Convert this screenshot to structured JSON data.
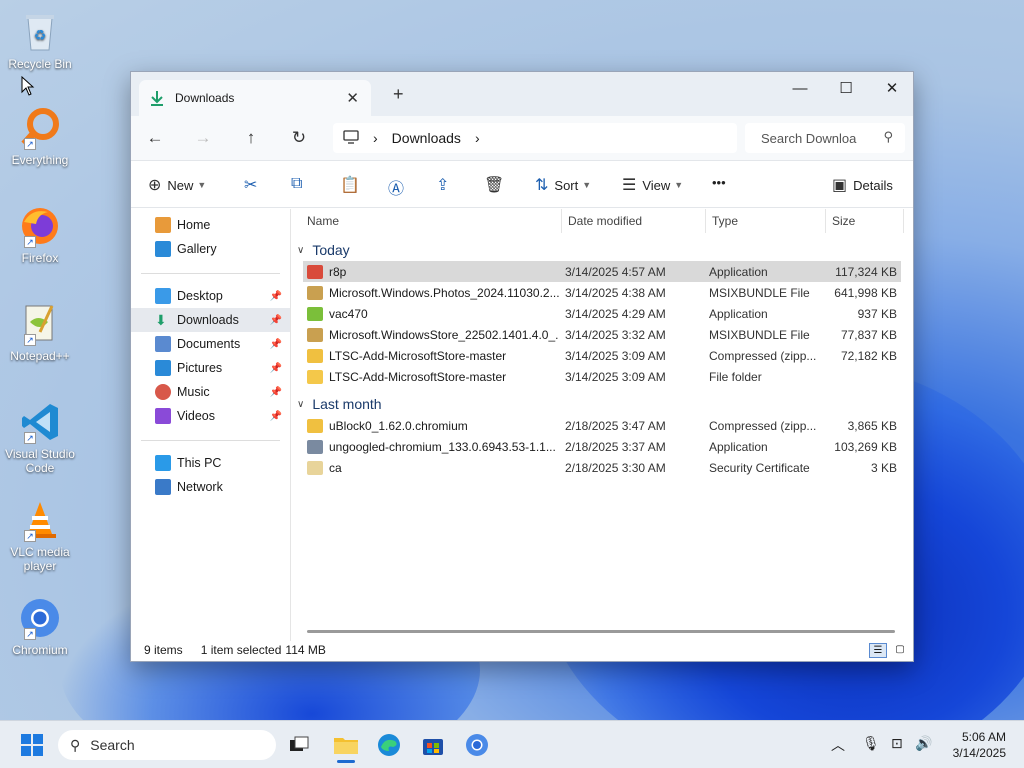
{
  "desktop": {
    "icons": [
      {
        "label": "Recycle Bin",
        "icon": "recycle-bin-icon"
      },
      {
        "label": "Everything",
        "icon": "everything-search-icon"
      },
      {
        "label": "Firefox",
        "icon": "firefox-icon"
      },
      {
        "label": "Notepad++",
        "icon": "notepadpp-icon"
      },
      {
        "label": "Visual Studio Code",
        "icon": "vscode-icon"
      },
      {
        "label": "VLC media player",
        "icon": "vlc-icon"
      },
      {
        "label": "Chromium",
        "icon": "chromium-icon"
      }
    ]
  },
  "window": {
    "tab_title": "Downloads",
    "new_tab": "+",
    "close_tab": "✕",
    "controls": {
      "minimize": "—",
      "maximize": "☐",
      "close": "✕"
    },
    "breadcrumb": {
      "location": "Downloads"
    },
    "search_placeholder": "Search Downloa",
    "toolbar": {
      "new": "New",
      "sort": "Sort",
      "view": "View",
      "more": "•••",
      "details": "Details"
    },
    "nav": {
      "home": "Home",
      "gallery": "Gallery",
      "desktop": "Desktop",
      "downloads": "Downloads",
      "documents": "Documents",
      "pictures": "Pictures",
      "music": "Music",
      "videos": "Videos",
      "this_pc": "This PC",
      "network": "Network"
    },
    "columns": {
      "name": "Name",
      "date": "Date modified",
      "type": "Type",
      "size": "Size"
    },
    "groups": {
      "today": "Today",
      "last_month": "Last month"
    },
    "files_today": [
      {
        "name": "r8p",
        "date": "3/14/2025 4:57 AM",
        "type": "Application",
        "size": "117,324 KB",
        "icon": "app-icon",
        "color": "#d94a3a"
      },
      {
        "name": "Microsoft.Windows.Photos_2024.11030.2...",
        "date": "3/14/2025 4:38 AM",
        "type": "MSIXBUNDLE File",
        "size": "641,998 KB",
        "icon": "package-icon",
        "color": "#c9a050"
      },
      {
        "name": "vac470",
        "date": "3/14/2025 4:29 AM",
        "type": "Application",
        "size": "937 KB",
        "icon": "app-icon",
        "color": "#7bbf3a"
      },
      {
        "name": "Microsoft.WindowsStore_22502.1401.4.0_...",
        "date": "3/14/2025 3:32 AM",
        "type": "MSIXBUNDLE File",
        "size": "77,837 KB",
        "icon": "package-icon",
        "color": "#c9a050"
      },
      {
        "name": "LTSC-Add-MicrosoftStore-master",
        "date": "3/14/2025 3:09 AM",
        "type": "Compressed (zipp...",
        "size": "72,182 KB",
        "icon": "zip-folder-icon",
        "color": "#f0c040"
      },
      {
        "name": "LTSC-Add-MicrosoftStore-master",
        "date": "3/14/2025 3:09 AM",
        "type": "File folder",
        "size": "",
        "icon": "folder-icon",
        "color": "#f4c84a"
      }
    ],
    "files_last_month": [
      {
        "name": "uBlock0_1.62.0.chromium",
        "date": "2/18/2025 3:47 AM",
        "type": "Compressed (zipp...",
        "size": "3,865 KB",
        "icon": "zip-folder-icon",
        "color": "#f0c040"
      },
      {
        "name": "ungoogled-chromium_133.0.6943.53-1.1...",
        "date": "2/18/2025 3:37 AM",
        "type": "Application",
        "size": "103,269 KB",
        "icon": "installer-icon",
        "color": "#7a8aa0"
      },
      {
        "name": "ca",
        "date": "2/18/2025 3:30 AM",
        "type": "Security Certificate",
        "size": "3 KB",
        "icon": "certificate-icon",
        "color": "#e8d49a"
      }
    ],
    "status": {
      "items": "9 items",
      "selected": "1 item selected",
      "size": "114 MB"
    }
  },
  "taskbar": {
    "search": "Search",
    "time": "5:06 AM",
    "date": "3/14/2025"
  }
}
